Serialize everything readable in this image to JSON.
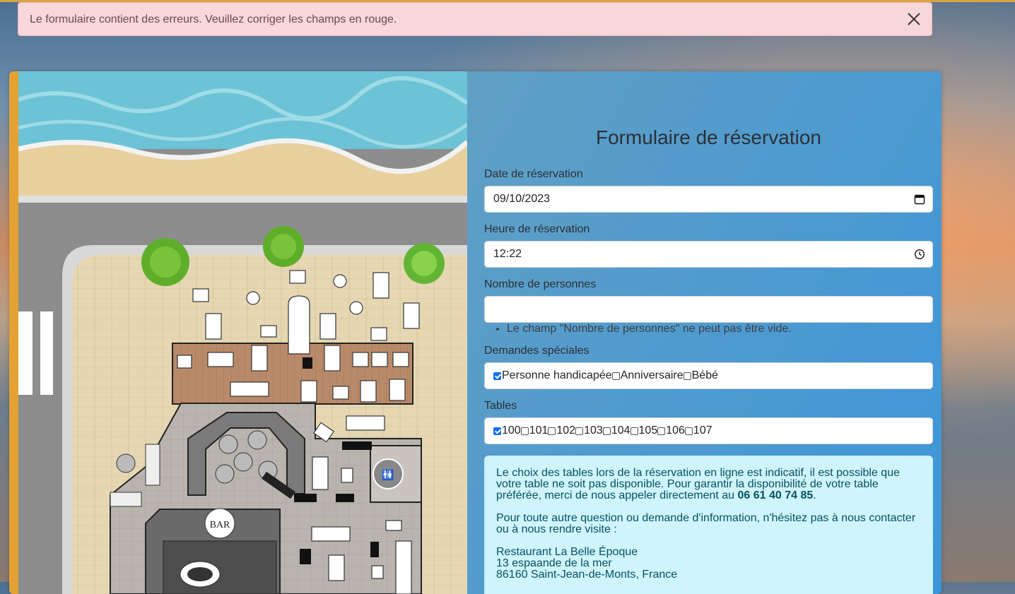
{
  "alert": {
    "message": "Le formulaire contient des erreurs. Veuillez corriger les champs en rouge.",
    "close_icon": "close-icon"
  },
  "form": {
    "title": "Formulaire de réservation",
    "date": {
      "label": "Date de réservation",
      "value": "09/10/2023",
      "icon": "calendar-icon"
    },
    "time": {
      "label": "Heure de réservation",
      "value": "12:22",
      "icon": "clock-icon"
    },
    "people": {
      "label": "Nombre de personnes",
      "value": "",
      "error": "Le champ \"Nombre de personnes\" ne peut pas être vide."
    },
    "special": {
      "label": "Demandes spéciales",
      "options": [
        {
          "label": "Personne handicapée",
          "checked": true
        },
        {
          "label": "Anniversaire",
          "checked": false
        },
        {
          "label": "Bébé",
          "checked": false
        }
      ]
    },
    "tables": {
      "label": "Tables",
      "options": [
        {
          "label": "100",
          "checked": true
        },
        {
          "label": "101",
          "checked": false
        },
        {
          "label": "102",
          "checked": false
        },
        {
          "label": "103",
          "checked": false
        },
        {
          "label": "104",
          "checked": false
        },
        {
          "label": "105",
          "checked": false
        },
        {
          "label": "106",
          "checked": false
        },
        {
          "label": "107",
          "checked": false
        }
      ]
    }
  },
  "info": {
    "para1": "Le choix des tables lors de la réservation en ligne est indicatif, il est possible que votre table ne soit pas disponible. Pour garantir la disponibilité de votre table préférée, merci de nous appeler directement au ",
    "phone": "06 61 40 74 85",
    "para1_end": ".",
    "para2": "Pour toute autre question ou demande d'information, n'hésitez pas à nous contacter ou à nous rendre visite :",
    "restaurant_name": "Restaurant La Belle Époque",
    "address_line1": "13 espaande de la mer",
    "address_line2": "86160 Saint-Jean-de-Monts, France"
  },
  "map": {
    "sign": "BAR",
    "colors": {
      "sea": "#6cc3d5",
      "sand": "#e7cf9e",
      "terrace": "#e6d7b3",
      "deck": "#b98a6a",
      "road": "#8d8d8d"
    }
  },
  "colors": {
    "accent": "#e3a233",
    "alert_bg": "#f8d7da",
    "info_bg": "#cff4fc"
  }
}
